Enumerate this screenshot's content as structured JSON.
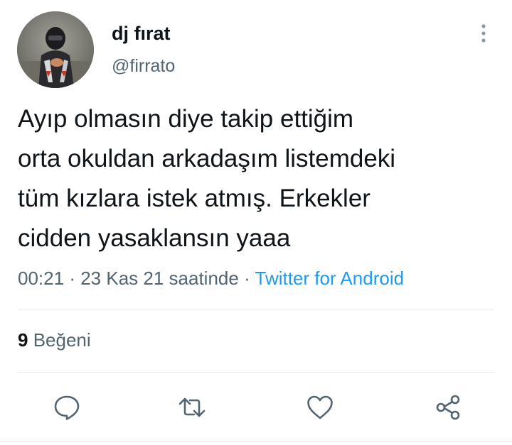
{
  "author": {
    "display_name": "dj fırat",
    "handle": "@firrato"
  },
  "tweet": {
    "text": "Ayıp olmasın diye takip ettiğim\norta okuldan arkadaşım listemdeki\ntüm kızlara istek atmış. Erkekler\ncidden yasaklansın yaaa",
    "time": "00:21",
    "separator": "·",
    "date": "23 Kas 21 saatinde",
    "source": "Twitter for Android"
  },
  "stats": {
    "likes_count": "9",
    "likes_label": "Beğeni"
  },
  "actions": {
    "reply_icon": "reply-icon",
    "retweet_icon": "retweet-icon",
    "like_icon": "heart-icon",
    "share_icon": "share-icon"
  },
  "colors": {
    "text": "#0f1419",
    "secondary": "#536471",
    "link": "#1d9bf0",
    "divider": "#e7e9ea"
  }
}
